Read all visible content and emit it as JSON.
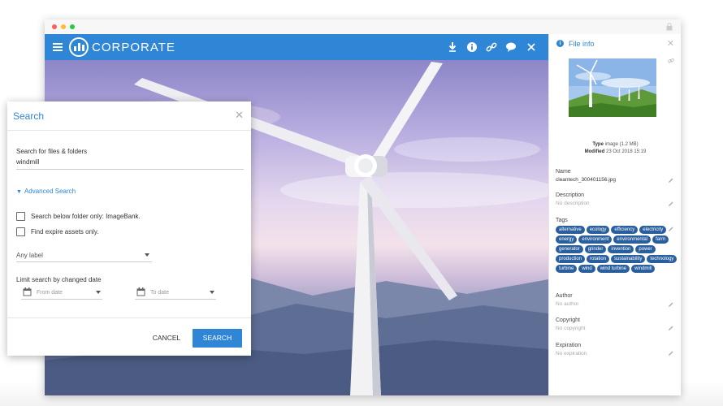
{
  "app": {
    "brand": "CORPORATE"
  },
  "toolbar": {
    "icons": [
      "download-icon",
      "info-icon",
      "link-icon",
      "comment-icon",
      "close-icon"
    ]
  },
  "colors": {
    "accent": "#2f86d6",
    "tag_bg": "#2a5f9e"
  },
  "file_info": {
    "title": "File info",
    "type_label": "Type",
    "type_value": "image (1.2 MB)",
    "modified_label": "Modified",
    "modified_value": "23 Oct 2018 15:19",
    "name_label": "Name",
    "name_value": "cleantech_300401156.jpg",
    "description_label": "Description",
    "description_value": "No description",
    "tags_label": "Tags",
    "tags": [
      "alternative",
      "ecology",
      "efficiency",
      "electricity",
      "energy",
      "environment",
      "environmental",
      "farm",
      "generator",
      "grinder",
      "invention",
      "power",
      "production",
      "rotation",
      "sustainability",
      "technology",
      "turbine",
      "wind",
      "wind turbine",
      "windmill"
    ],
    "author_label": "Author",
    "author_value": "No author",
    "copyright_label": "Copyright",
    "copyright_value": "No copyright",
    "expiration_label": "Expiration",
    "expiration_value": "No expiration"
  },
  "search": {
    "title": "Search",
    "query_label": "Search for files & folders",
    "query_value": "windmill",
    "advanced_label": "Advanced Search",
    "below_folder_label": "Search below folder only: ",
    "below_folder_name": "ImageBank.",
    "expire_label": "Find expire assets only.",
    "label_select": "Any label",
    "date_limit_label": "Limit search by changed date",
    "from_placeholder": "From date",
    "to_placeholder": "To date",
    "cancel_label": "CANCEL",
    "search_label": "SEARCH"
  }
}
